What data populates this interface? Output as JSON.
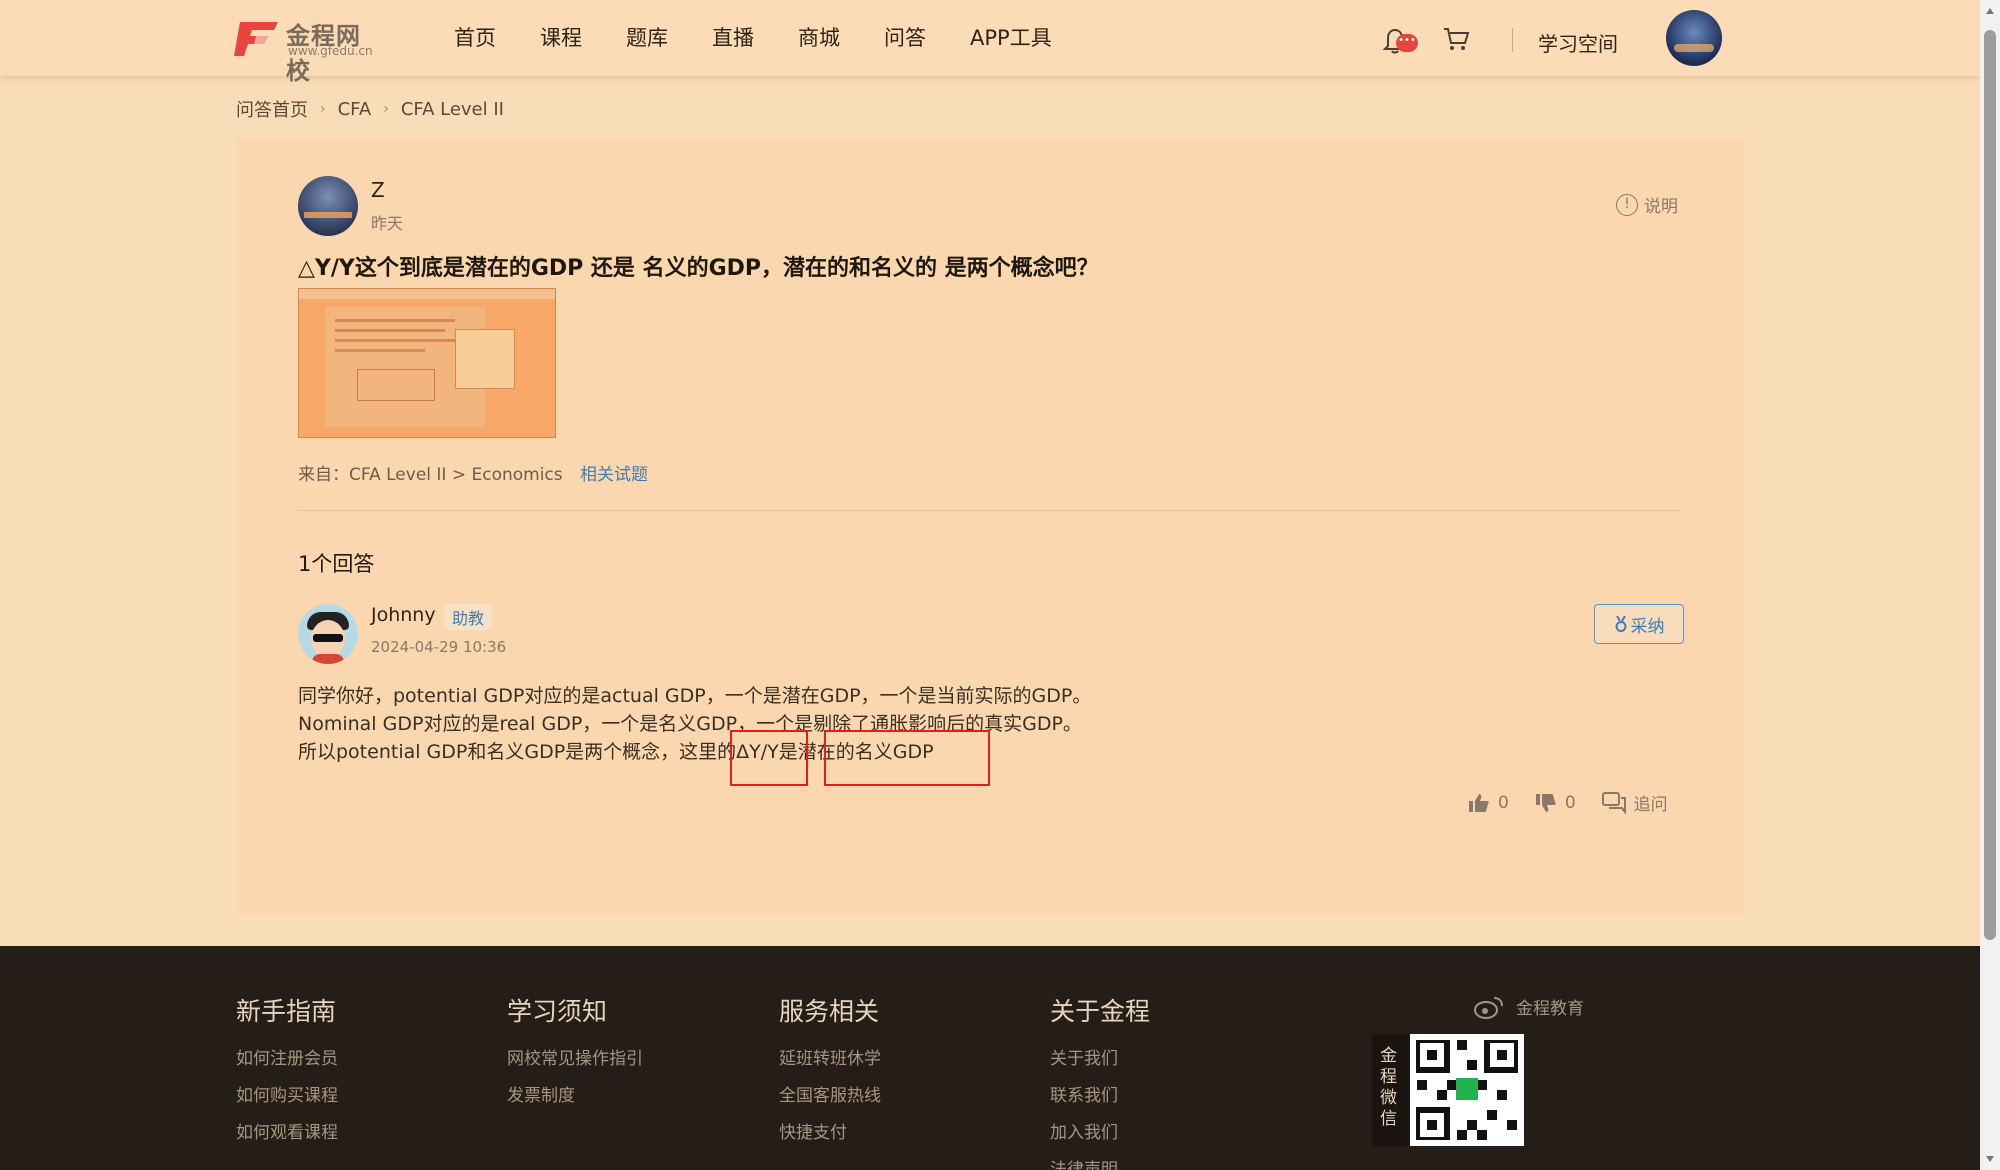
{
  "header": {
    "logo_text": "金程网校",
    "logo_url": "www.gfedu.cn",
    "nav": [
      "首页",
      "课程",
      "题库",
      "直播",
      "商城",
      "问答",
      "APP工具"
    ],
    "bell_badge": "•••",
    "study_label": "学习空间"
  },
  "breadcrumb": {
    "items": [
      "问答首页",
      "CFA",
      "CFA Level II"
    ],
    "separator": "›"
  },
  "question": {
    "author": "Z",
    "time": "昨天",
    "explain_label": "说明",
    "title": "△Y/Y这个到底是潜在的GDP 还是 名义的GDP，潜在的和名义的 是两个概念吧？",
    "source": "来自：CFA Level II > Economics",
    "related_label": "相关试题"
  },
  "answers": {
    "count_label": "1个回答",
    "items": [
      {
        "author": "Johnny",
        "role": "助教",
        "time": "2024-04-29 10:36",
        "adopt_label": "采纳",
        "lines": [
          "同学你好，potential GDP对应的是actual GDP，一个是潜在GDP，一个是当前实际的GDP。",
          "Nominal GDP对应的是real GDP，一个是名义GDP，一个是剔除了通胀影响后的真实GDP。",
          "所以potential GDP和名义GDP是两个概念，这里的ΔY/Y是潜在的名义GDP"
        ],
        "likes": "0",
        "dislikes": "0",
        "followup_label": "追问"
      }
    ]
  },
  "footer": {
    "columns": [
      {
        "title": "新手指南",
        "links": [
          "如何注册会员",
          "如何购买课程",
          "如何观看课程"
        ]
      },
      {
        "title": "学习须知",
        "links": [
          "网校常见操作指引",
          "发票制度"
        ]
      },
      {
        "title": "服务相关",
        "links": [
          "延班转班休学",
          "全国客服热线",
          "快捷支付"
        ]
      },
      {
        "title": "关于金程",
        "links": [
          "关于我们",
          "联系我们",
          "加入我们",
          "法律声明"
        ]
      }
    ],
    "weibo_label": "金程教育",
    "wechat_label": "金程微信"
  },
  "colors": {
    "brand_red": "#e8453c",
    "link_blue": "#3c7dbb",
    "highlight_red": "#e11f17",
    "page_bg": "#f9ddb9",
    "footer_bg": "#251e18"
  }
}
